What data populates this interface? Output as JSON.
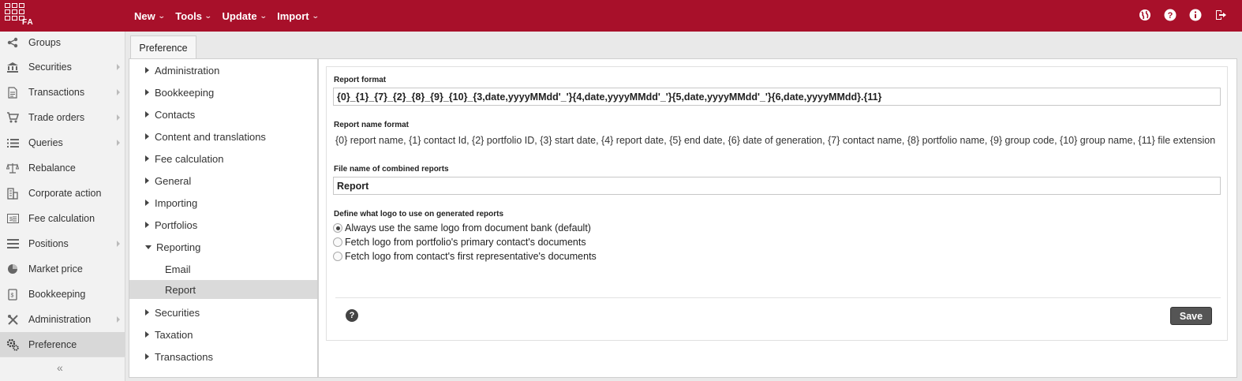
{
  "app": {
    "logo_text": "FA"
  },
  "topmenu": [
    {
      "label": "New"
    },
    {
      "label": "Tools"
    },
    {
      "label": "Update"
    },
    {
      "label": "Import"
    }
  ],
  "sidebar": {
    "items": [
      {
        "label": "Groups",
        "icon": "share-icon",
        "has_submenu": false
      },
      {
        "label": "Securities",
        "icon": "bank-icon",
        "has_submenu": true
      },
      {
        "label": "Transactions",
        "icon": "document-icon",
        "has_submenu": true
      },
      {
        "label": "Trade orders",
        "icon": "cart-icon",
        "has_submenu": true
      },
      {
        "label": "Queries",
        "icon": "list-icon",
        "has_submenu": true
      },
      {
        "label": "Rebalance",
        "icon": "scale-icon",
        "has_submenu": false
      },
      {
        "label": "Corporate action",
        "icon": "building-icon",
        "has_submenu": false
      },
      {
        "label": "Fee calculation",
        "icon": "calculator-icon",
        "has_submenu": false
      },
      {
        "label": "Positions",
        "icon": "lines-icon",
        "has_submenu": true
      },
      {
        "label": "Market price",
        "icon": "pie-icon",
        "has_submenu": false
      },
      {
        "label": "Bookkeeping",
        "icon": "book-icon",
        "has_submenu": false
      },
      {
        "label": "Administration",
        "icon": "tools-icon",
        "has_submenu": true
      },
      {
        "label": "Preference",
        "icon": "gears-icon",
        "has_submenu": false,
        "active": true
      }
    ],
    "collapse_label": "«"
  },
  "tab": {
    "label": "Preference"
  },
  "tree": [
    {
      "label": "Administration"
    },
    {
      "label": "Bookkeeping"
    },
    {
      "label": "Contacts"
    },
    {
      "label": "Content and translations"
    },
    {
      "label": "Fee calculation"
    },
    {
      "label": "General"
    },
    {
      "label": "Importing"
    },
    {
      "label": "Portfolios"
    },
    {
      "label": "Reporting",
      "expanded": true
    },
    {
      "label": "Email",
      "child": true
    },
    {
      "label": "Report",
      "child": true,
      "selected": true
    },
    {
      "label": "Securities"
    },
    {
      "label": "Taxation"
    },
    {
      "label": "Transactions"
    }
  ],
  "form": {
    "report_format_label": "Report format",
    "report_format_value": "{0}_{1}_{7}_{2}_{8}_{9}_{10}_{3,date,yyyyMMdd'_'}{4,date,yyyyMMdd'_'}{5,date,yyyyMMdd'_'}{6,date,yyyyMMdd}.{11}",
    "report_name_format_label": "Report name format",
    "report_name_format_text": "{0} report name, {1} contact Id, {2} portfolio ID, {3} start date, {4} report date, {5} end date, {6} date of generation, {7} contact name, {8} portfolio name, {9} group code, {10} group name, {11} file extension",
    "combined_label": "File name of combined reports",
    "combined_value": "Report",
    "logo_label": "Define what logo to use on generated reports",
    "logo_options": [
      {
        "label": "Always use the same logo from document bank (default)",
        "checked": true
      },
      {
        "label": "Fetch logo from portfolio's primary contact's documents",
        "checked": false
      },
      {
        "label": "Fetch logo from contact's first representative's documents",
        "checked": false
      }
    ],
    "help_label": "?",
    "save_label": "Save"
  },
  "colors": {
    "brand": "#a8102a"
  }
}
